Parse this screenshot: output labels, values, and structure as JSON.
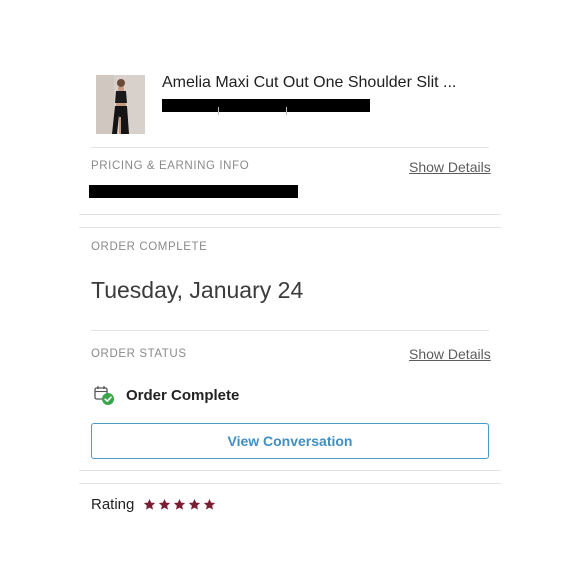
{
  "product": {
    "title": "Amelia Maxi Cut Out One Shoulder Slit ..."
  },
  "pricing": {
    "label": "PRICING & EARNING INFO",
    "show_details": "Show Details"
  },
  "order_complete": {
    "label": "ORDER COMPLETE",
    "date": "Tuesday, January 24"
  },
  "order_status": {
    "label": "ORDER STATUS",
    "show_details": "Show Details",
    "status_text": "Order Complete",
    "status_icon": "order-complete-check-icon"
  },
  "actions": {
    "view_conversation": "View Conversation"
  },
  "rating": {
    "label": "Rating",
    "stars": 5,
    "max_stars": 5,
    "star_color": "#7a1f33"
  },
  "colors": {
    "link": "#3f8fbf",
    "success": "#3aa64a"
  }
}
